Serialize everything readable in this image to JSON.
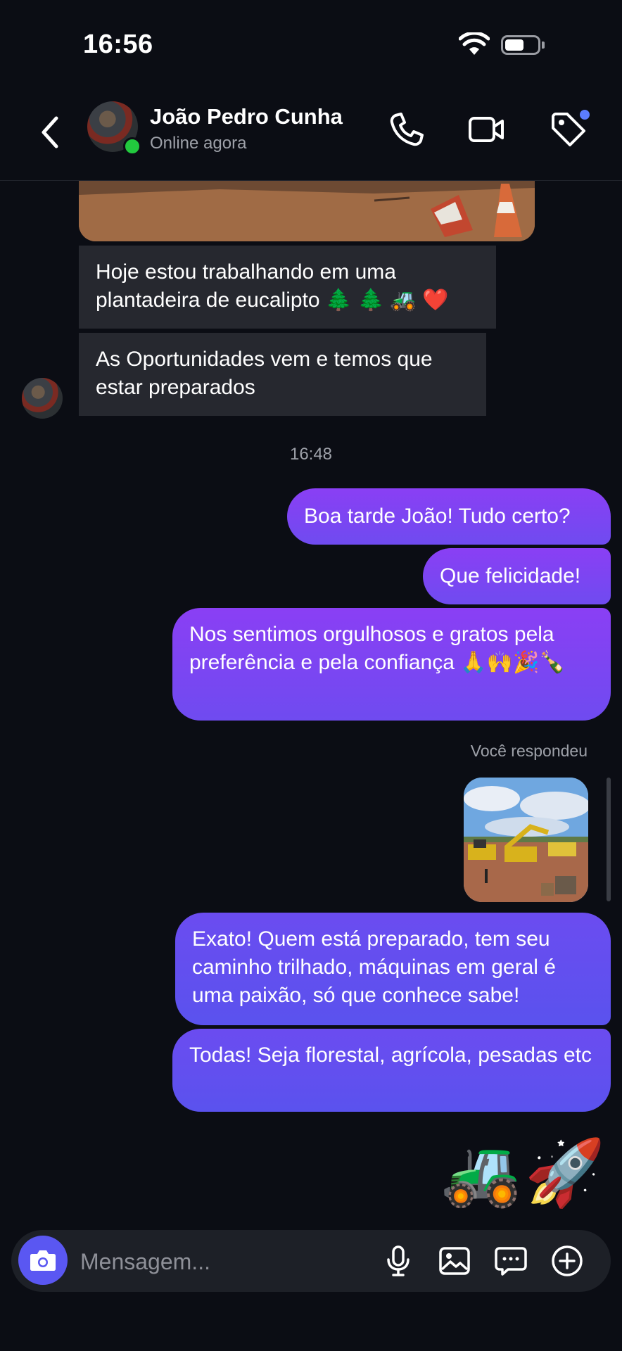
{
  "status_bar": {
    "time": "16:56"
  },
  "header": {
    "contact_name": "João Pedro Cunha",
    "contact_status": "Online agora",
    "icons": [
      "back-icon",
      "phone-icon",
      "video-icon",
      "tag-icon"
    ]
  },
  "messages": {
    "incoming": [
      "Hoje estou trabalhando em uma plantadeira de eucalipto 🌲 🌲 🚜 ❤️",
      "As Oportunidades vem e temos que estar preparados"
    ],
    "timestamp": "16:48",
    "outgoing": [
      "Boa tarde João! Tudo certo?",
      "Que felicidade!",
      "Nos sentimos orgulhosos e gratos pela preferência e pela confiança 🙏🙌🎉🍾"
    ],
    "replied_label": "Você respondeu",
    "outgoing_after": [
      "Exato! Quem está preparado, tem seu caminho trilhado, máquinas em geral é uma paixão, só que conhece sabe!",
      "Todas! Seja florestal, agrícola, pesadas etc"
    ],
    "emoji_reply": "🚜🚀"
  },
  "composer": {
    "placeholder": "Mensagem...",
    "icons": [
      "camera-icon",
      "microphone-icon",
      "image-icon",
      "sticker-icon",
      "plus-icon"
    ]
  },
  "colors": {
    "background": "#0b0d14",
    "incoming_bubble": "#26282f",
    "outgoing_bubble": "#7d45f2",
    "online": "#22c93e",
    "accent": "#5a57f2"
  }
}
